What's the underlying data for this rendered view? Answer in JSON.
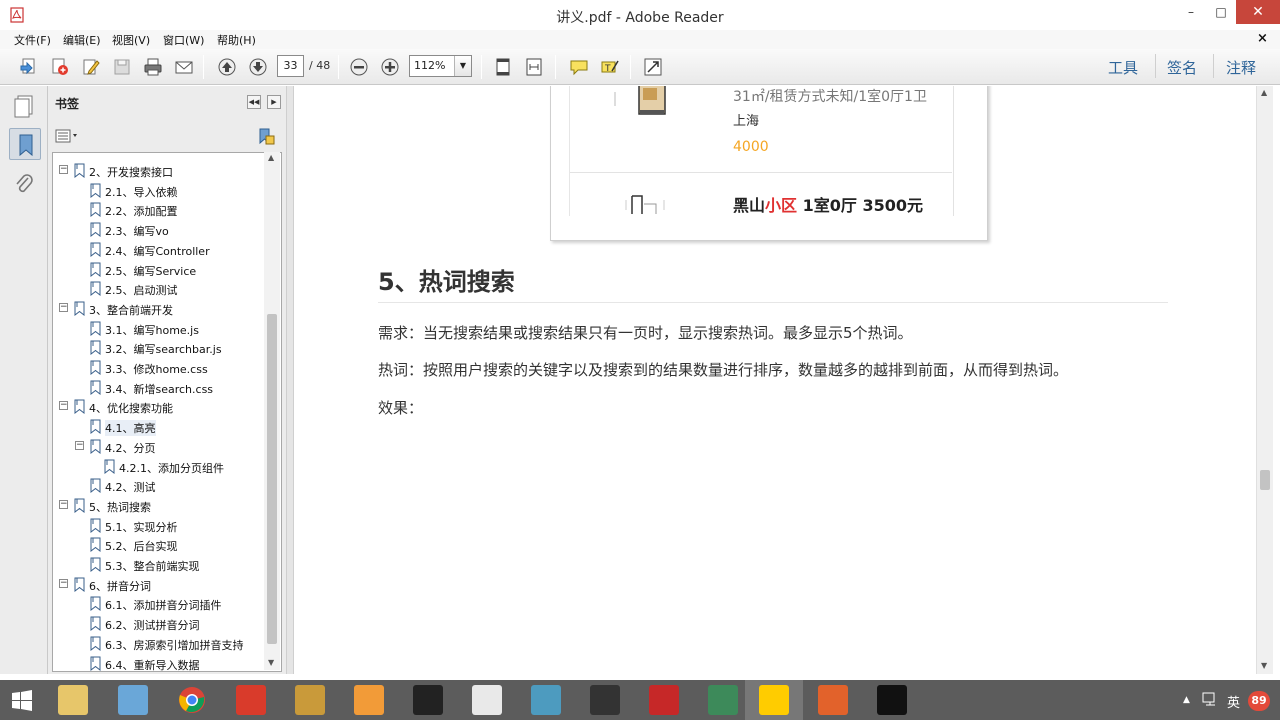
{
  "window": {
    "title": "讲义.pdf - Adobe Reader",
    "min_glyph": "–",
    "max_glyph": "□",
    "close_glyph": "✕"
  },
  "menu": {
    "items": [
      "文件(F)",
      "编辑(E)",
      "视图(V)",
      "窗口(W)",
      "帮助(H)"
    ],
    "doc_close": "×"
  },
  "toolbar": {
    "page_current": "33",
    "page_total": "/ 48",
    "zoom": "112%",
    "zoom_dd": "▼",
    "tools_label": "工具",
    "sign_label": "签名",
    "comment_label": "注释"
  },
  "bookmarks": {
    "title": "书签",
    "collapse_glyph": "◀◀",
    "close_glyph": "▶",
    "items": [
      {
        "label": "2、开发搜索接口",
        "level": 0
      },
      {
        "label": "2.1、导入依赖",
        "level": 1
      },
      {
        "label": "2.2、添加配置",
        "level": 1
      },
      {
        "label": "2.3、编写vo",
        "level": 1
      },
      {
        "label": "2.4、编写Controller",
        "level": 1
      },
      {
        "label": "2.5、编写Service",
        "level": 1
      },
      {
        "label": "2.5、启动测试",
        "level": 1
      },
      {
        "label": "3、整合前端开发",
        "level": 0
      },
      {
        "label": "3.1、编写home.js",
        "level": 1
      },
      {
        "label": "3.2、编写searchbar.js",
        "level": 1
      },
      {
        "label": "3.3、修改home.css",
        "level": 1
      },
      {
        "label": "3.4、新增search.css",
        "level": 1
      },
      {
        "label": "4、优化搜索功能",
        "level": 0
      },
      {
        "label": "4.1、高亮",
        "level": 1
      },
      {
        "label": "4.2、分页",
        "level": 1
      },
      {
        "label": "4.2.1、添加分页组件",
        "level": 2
      },
      {
        "label": "4.2、测试",
        "level": 1
      },
      {
        "label": "5、热词搜索",
        "level": 0
      },
      {
        "label": "5.1、实现分析",
        "level": 1
      },
      {
        "label": "5.2、后台实现",
        "level": 1
      },
      {
        "label": "5.3、整合前端实现",
        "level": 1
      },
      {
        "label": "6、拼音分词",
        "level": 0
      },
      {
        "label": "6.1、添加拼音分词插件",
        "level": 1
      },
      {
        "label": "6.2、测试拼音分词",
        "level": 1
      },
      {
        "label": "6.3、房源索引增加拼音支持",
        "level": 1
      },
      {
        "label": "6.4、重新导入数据",
        "level": 1
      }
    ]
  },
  "document": {
    "listing1_line": "31㎡/租赁方式未知/1室0厅1卫",
    "listing1_location": "上海",
    "listing1_price": "4000",
    "listing2_title_a": "黑山",
    "listing2_title_hl": "小区",
    "listing2_title_b": " 1室0厅 3500元",
    "section_heading": "5、热词搜索",
    "para1": "需求：当无搜索结果或搜索结果只有一页时，显示搜索热词。最多显示5个热词。",
    "para2": "热词：按照用户搜索的关键字以及搜索到的结果数量进行排序，数量越多的越排到前面，从而得到热词。",
    "para3": "效果："
  },
  "taskbar": {
    "apps": [
      "start-icon",
      "file-explorer-icon",
      "paint-icon",
      "chrome-icon",
      "xmind-icon",
      "winrar-icon",
      "sublime-icon",
      "intellij-icon",
      "red-app-icon",
      "notebook-icon",
      "terminal-app-icon",
      "adobe-reader-icon",
      "presentation-icon",
      "video-player-icon",
      "postman-icon",
      "cmd-icon"
    ],
    "tray_up": "▲",
    "ime": "英",
    "badge": "89"
  },
  "colors": {
    "accent_link": "#2f6599",
    "price": "#f5a623",
    "highlight_red": "#e03131",
    "close_red": "#c7463b"
  }
}
